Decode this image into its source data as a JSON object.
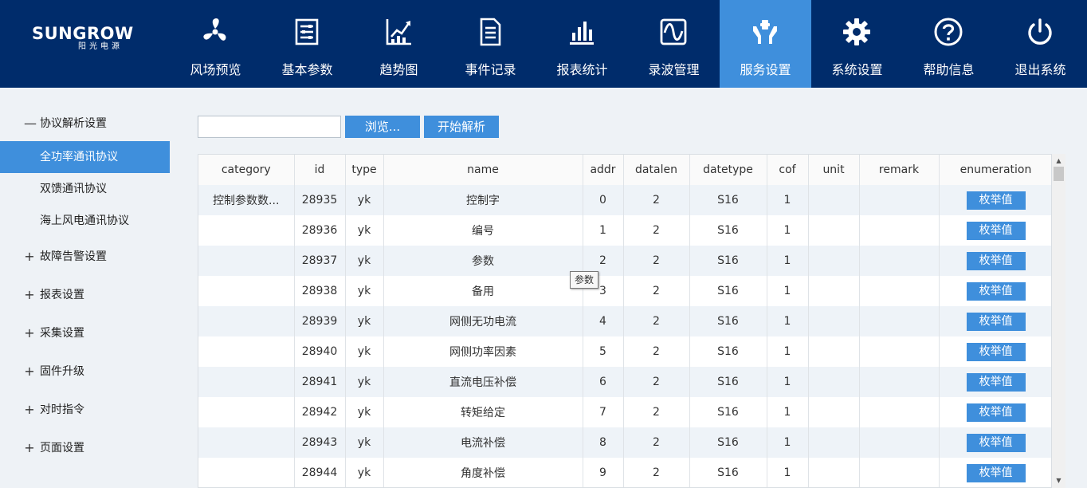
{
  "brand": {
    "name": "SUNGROW",
    "sub": "阳光电源"
  },
  "nav": [
    {
      "label": "风场预览",
      "icon": "fan-icon"
    },
    {
      "label": "基本参数",
      "icon": "parameter-list-icon"
    },
    {
      "label": "趋势图",
      "icon": "trend-chart-icon"
    },
    {
      "label": "事件记录",
      "icon": "document-icon"
    },
    {
      "label": "报表统计",
      "icon": "bar-chart-icon"
    },
    {
      "label": "录波管理",
      "icon": "waveform-icon"
    },
    {
      "label": "服务设置",
      "icon": "service-hands-icon",
      "active": true
    },
    {
      "label": "系统设置",
      "icon": "gear-icon"
    },
    {
      "label": "帮助信息",
      "icon": "help-icon"
    },
    {
      "label": "退出系统",
      "icon": "power-icon"
    }
  ],
  "sidebar": {
    "groups": [
      {
        "label": "协议解析设置",
        "sign": "—",
        "expanded": true,
        "items": [
          {
            "label": "全功率通讯协议",
            "active": true
          },
          {
            "label": "双馈通讯协议"
          },
          {
            "label": "海上风电通讯协议"
          }
        ]
      },
      {
        "label": "故障告警设置",
        "sign": "+"
      },
      {
        "label": "报表设置",
        "sign": "+"
      },
      {
        "label": "采集设置",
        "sign": "+"
      },
      {
        "label": "固件升级",
        "sign": "+"
      },
      {
        "label": "对时指令",
        "sign": "+"
      },
      {
        "label": "页面设置",
        "sign": "+"
      }
    ]
  },
  "toolbar": {
    "file_value": "",
    "browse_label": "浏览...",
    "parse_label": "开始解析"
  },
  "table": {
    "headers": [
      "category",
      "id",
      "type",
      "name",
      "addr",
      "datalen",
      "datetype",
      "cof",
      "unit",
      "remark",
      "enumeration"
    ],
    "enum_label": "枚举值",
    "rows": [
      [
        "控制参数数...",
        "28935",
        "yk",
        "控制字",
        "0",
        "2",
        "S16",
        "1",
        "",
        ""
      ],
      [
        "",
        "28936",
        "yk",
        "编号",
        "1",
        "2",
        "S16",
        "1",
        "",
        ""
      ],
      [
        "",
        "28937",
        "yk",
        "参数",
        "2",
        "2",
        "S16",
        "1",
        "",
        ""
      ],
      [
        "",
        "28938",
        "yk",
        "备用",
        "3",
        "2",
        "S16",
        "1",
        "",
        ""
      ],
      [
        "",
        "28939",
        "yk",
        "网侧无功电流",
        "4",
        "2",
        "S16",
        "1",
        "",
        ""
      ],
      [
        "",
        "28940",
        "yk",
        "网侧功率因素",
        "5",
        "2",
        "S16",
        "1",
        "",
        ""
      ],
      [
        "",
        "28941",
        "yk",
        "直流电压补偿",
        "6",
        "2",
        "S16",
        "1",
        "",
        ""
      ],
      [
        "",
        "28942",
        "yk",
        "转矩给定",
        "7",
        "2",
        "S16",
        "1",
        "",
        ""
      ],
      [
        "",
        "28943",
        "yk",
        "电流补偿",
        "8",
        "2",
        "S16",
        "1",
        "",
        ""
      ],
      [
        "",
        "28944",
        "yk",
        "角度补偿",
        "9",
        "2",
        "S16",
        "1",
        "",
        ""
      ]
    ]
  },
  "tooltip": "参数",
  "colors": {
    "header_bg": "#002c6b",
    "accent": "#3f8fdc",
    "page_bg": "#eef2f6"
  }
}
